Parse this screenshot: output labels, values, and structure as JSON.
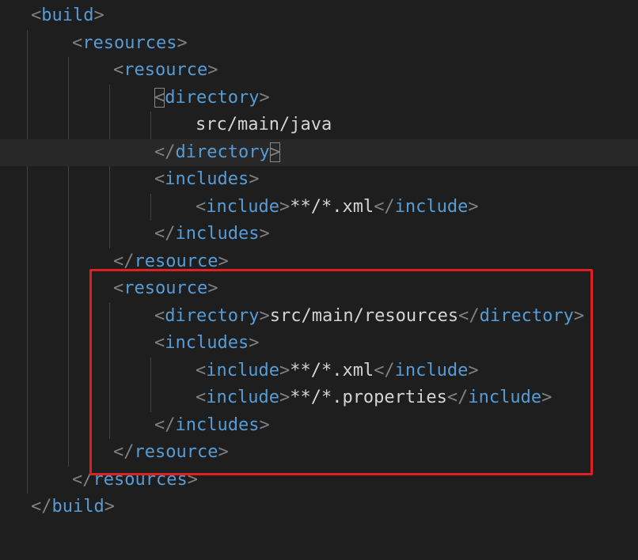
{
  "editor": {
    "lines": [
      {
        "indent": 0,
        "parts": [
          {
            "t": "<",
            "c": "punc"
          },
          {
            "t": "build",
            "c": "tag"
          },
          {
            "t": ">",
            "c": "punc"
          }
        ]
      },
      {
        "indent": 1,
        "parts": [
          {
            "t": "<",
            "c": "punc"
          },
          {
            "t": "resources",
            "c": "tag"
          },
          {
            "t": ">",
            "c": "punc"
          }
        ]
      },
      {
        "indent": 2,
        "parts": [
          {
            "t": "<",
            "c": "punc"
          },
          {
            "t": "resource",
            "c": "tag"
          },
          {
            "t": ">",
            "c": "punc"
          }
        ]
      },
      {
        "indent": 3,
        "parts": [
          {
            "t": "<",
            "c": "punc",
            "match": true
          },
          {
            "t": "directory",
            "c": "tag"
          },
          {
            "t": ">",
            "c": "punc"
          }
        ]
      },
      {
        "indent": 4,
        "parts": [
          {
            "t": "src/main/java",
            "c": "txt"
          }
        ]
      },
      {
        "indent": 3,
        "current": true,
        "parts": [
          {
            "t": "</",
            "c": "punc"
          },
          {
            "t": "directory",
            "c": "tag"
          },
          {
            "t": ">",
            "c": "punc",
            "match": true
          }
        ]
      },
      {
        "indent": 3,
        "parts": [
          {
            "t": "<",
            "c": "punc"
          },
          {
            "t": "includes",
            "c": "tag"
          },
          {
            "t": ">",
            "c": "punc"
          }
        ]
      },
      {
        "indent": 4,
        "parts": [
          {
            "t": "<",
            "c": "punc"
          },
          {
            "t": "include",
            "c": "tag"
          },
          {
            "t": ">",
            "c": "punc"
          },
          {
            "t": "**/*.xml",
            "c": "txt"
          },
          {
            "t": "</",
            "c": "punc"
          },
          {
            "t": "include",
            "c": "tag"
          },
          {
            "t": ">",
            "c": "punc"
          }
        ]
      },
      {
        "indent": 3,
        "parts": [
          {
            "t": "</",
            "c": "punc"
          },
          {
            "t": "includes",
            "c": "tag"
          },
          {
            "t": ">",
            "c": "punc"
          }
        ]
      },
      {
        "indent": 2,
        "parts": [
          {
            "t": "</",
            "c": "punc"
          },
          {
            "t": "resource",
            "c": "tag"
          },
          {
            "t": ">",
            "c": "punc"
          }
        ]
      },
      {
        "indent": 2,
        "parts": [
          {
            "t": "<",
            "c": "punc"
          },
          {
            "t": "resource",
            "c": "tag"
          },
          {
            "t": ">",
            "c": "punc"
          }
        ]
      },
      {
        "indent": 3,
        "parts": [
          {
            "t": "<",
            "c": "punc"
          },
          {
            "t": "directory",
            "c": "tag"
          },
          {
            "t": ">",
            "c": "punc"
          },
          {
            "t": "src/main/resources",
            "c": "txt"
          },
          {
            "t": "</",
            "c": "punc"
          },
          {
            "t": "directory",
            "c": "tag"
          },
          {
            "t": ">",
            "c": "punc"
          }
        ]
      },
      {
        "indent": 3,
        "parts": [
          {
            "t": "<",
            "c": "punc"
          },
          {
            "t": "includes",
            "c": "tag"
          },
          {
            "t": ">",
            "c": "punc"
          }
        ]
      },
      {
        "indent": 4,
        "parts": [
          {
            "t": "<",
            "c": "punc"
          },
          {
            "t": "include",
            "c": "tag"
          },
          {
            "t": ">",
            "c": "punc"
          },
          {
            "t": "**/*.xml",
            "c": "txt"
          },
          {
            "t": "</",
            "c": "punc"
          },
          {
            "t": "include",
            "c": "tag"
          },
          {
            "t": ">",
            "c": "punc"
          }
        ]
      },
      {
        "indent": 4,
        "parts": [
          {
            "t": "<",
            "c": "punc"
          },
          {
            "t": "include",
            "c": "tag"
          },
          {
            "t": ">",
            "c": "punc"
          },
          {
            "t": "**/*.properties",
            "c": "txt"
          },
          {
            "t": "</",
            "c": "punc"
          },
          {
            "t": "include",
            "c": "tag"
          },
          {
            "t": ">",
            "c": "punc"
          }
        ]
      },
      {
        "indent": 3,
        "parts": [
          {
            "t": "</",
            "c": "punc"
          },
          {
            "t": "includes",
            "c": "tag"
          },
          {
            "t": ">",
            "c": "punc"
          }
        ]
      },
      {
        "indent": 2,
        "parts": [
          {
            "t": "</",
            "c": "punc"
          },
          {
            "t": "resource",
            "c": "tag"
          },
          {
            "t": ">",
            "c": "punc"
          }
        ]
      },
      {
        "indent": 1,
        "parts": [
          {
            "t": "</",
            "c": "punc"
          },
          {
            "t": "resources",
            "c": "tag"
          },
          {
            "t": ">",
            "c": "punc"
          }
        ]
      },
      {
        "indent": 0,
        "parts": [
          {
            "t": "</",
            "c": "punc"
          },
          {
            "t": "build",
            "c": "tag"
          },
          {
            "t": ">",
            "c": "punc"
          }
        ]
      }
    ]
  },
  "colors": {
    "background": "#1e1e1e",
    "current_line": "#282828",
    "tag": "#569cd6",
    "punctuation": "#808080",
    "text": "#d4d4d4",
    "indent_guide": "#404040",
    "highlight_box": "#e02020"
  }
}
